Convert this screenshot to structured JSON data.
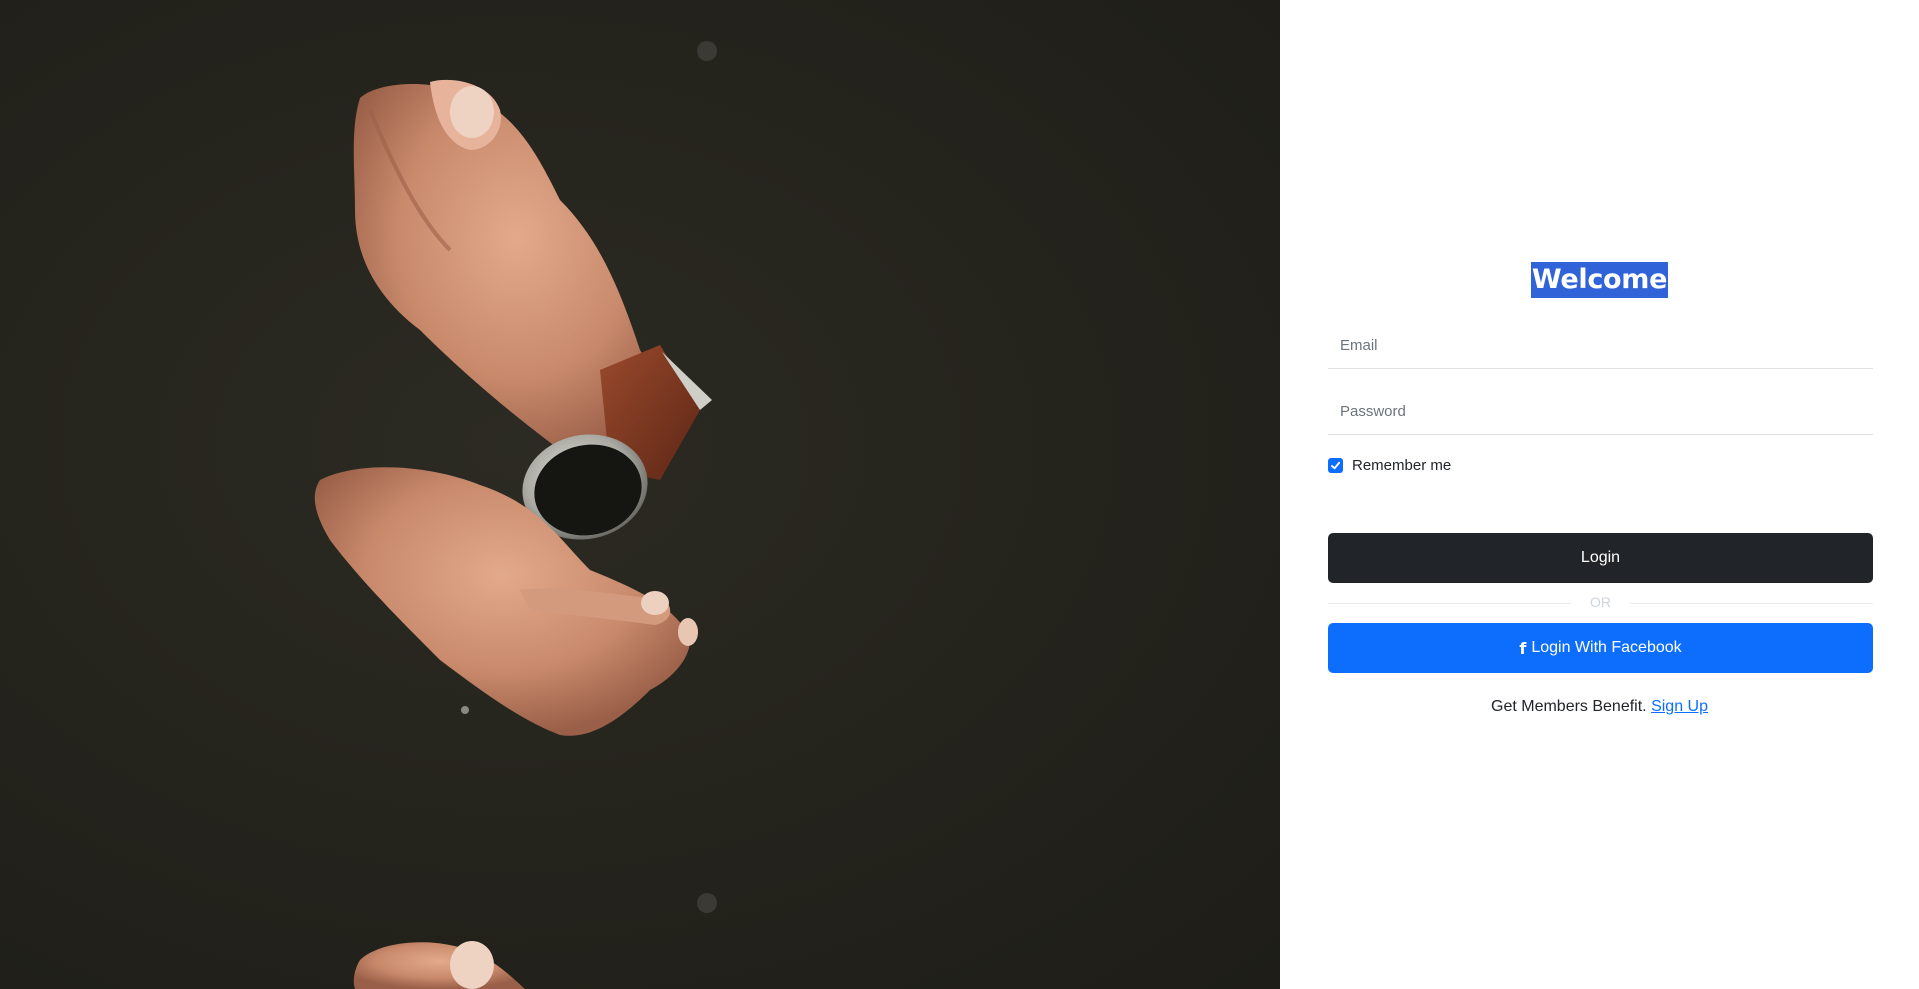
{
  "login": {
    "title": "Welcome",
    "email_placeholder": "Email",
    "password_placeholder": "Password",
    "remember_label": "Remember me",
    "remember_checked": true,
    "login_button": "Login",
    "divider_text": "OR",
    "facebook_button": "Login With Facebook",
    "signup_prefix": "Get Members Benefit.",
    "signup_link": "Sign Up"
  },
  "icons": {
    "facebook": "facebook-icon",
    "check": "check-icon"
  },
  "colors": {
    "primary": "#0d6efd",
    "dark": "#212529",
    "title_highlight": "#3063d8",
    "hero_background": "#25241d"
  }
}
